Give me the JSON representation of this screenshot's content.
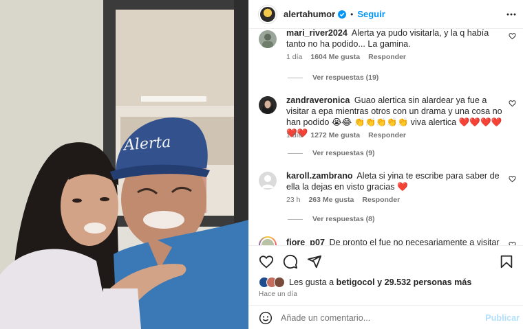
{
  "header": {
    "username": "alertahumor",
    "separator": "•",
    "follow_label": "Seguir"
  },
  "comments": [
    {
      "username": "mari_river2024",
      "text": "Alerta ya pudo visitarla, y la q había tanto no ha podido... La gamina.",
      "age": "1 día",
      "likes": "1604 Me gusta",
      "reply_label": "Responder",
      "view_replies": "Ver respuestas (19)"
    },
    {
      "username": "zandraveronica",
      "text": "Guao alertica sin alardear ya fue a visitar a epa mientras otros con un drama y una cosa no han podido",
      "emojis": "😭😂 👏👏👏👏👏 viva alertica ❤️❤️❤️❤️❤️❤️",
      "age": "1 día",
      "likes": "1272 Me gusta",
      "reply_label": "Responder",
      "view_replies": "Ver respuestas (9)"
    },
    {
      "username": "karoll.zambrano",
      "text": "Aleta si yina te escribe para saber de ella la dejas en visto gracias",
      "heart": "❤️",
      "age": "23 h",
      "likes": "263 Me gusta",
      "reply_label": "Responder",
      "view_replies": "Ver respuestas (8)"
    },
    {
      "username": "fiore_p07",
      "text": "De pronto el fue no necesariamente a visitar en"
    }
  ],
  "post": {
    "likes_prefix": "Les gusta a",
    "liked_by": "betigocol",
    "likes_suffix": "y 29.532 personas más",
    "time": "Hace un día",
    "comment_placeholder": "Añade un comentario...",
    "publish_label": "Publicar"
  },
  "photo": {
    "cap_text": "Alerta"
  },
  "colors": {
    "accent": "#0095f6",
    "publish_disabled": "#b2dffc",
    "heart": "#ed4956",
    "muted": "#737373"
  }
}
